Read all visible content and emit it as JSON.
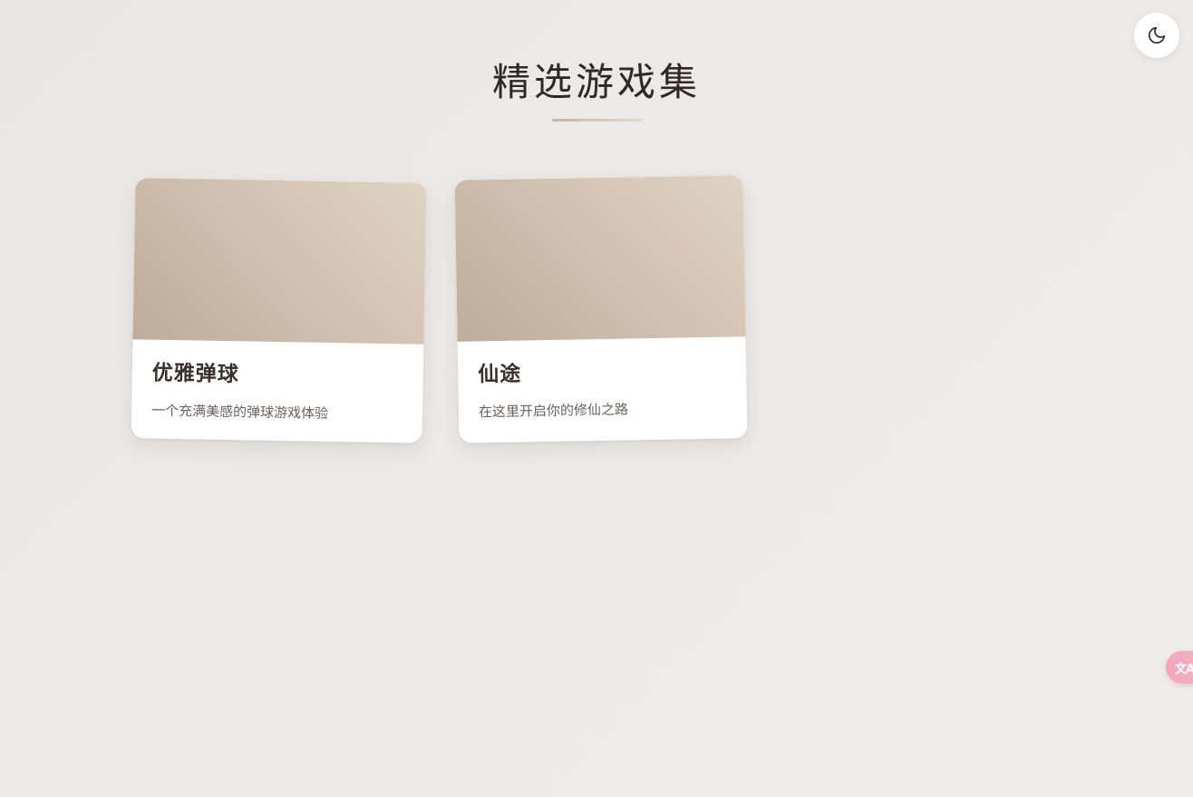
{
  "header": {
    "title": "精选游戏集",
    "theme_toggle_icon": "moon-icon"
  },
  "games": [
    {
      "title": "优雅弹球",
      "description": "一个充满美感的弹球游戏体验"
    },
    {
      "title": "仙途",
      "description": "在这里开启你的修仙之路"
    }
  ],
  "translate": {
    "icon": "translate-icon",
    "label": "文A"
  },
  "colors": {
    "background": "#ece8e5",
    "card_image_start": "#bfac9a",
    "card_image_end": "#e0d2c4",
    "translate_accent": "#f1a6bd"
  }
}
